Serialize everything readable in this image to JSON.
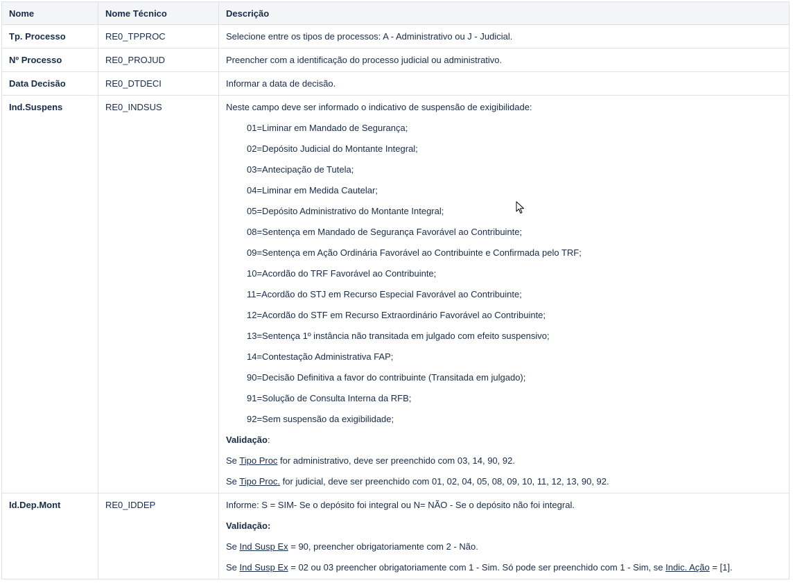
{
  "headers": [
    "Nome",
    "Nome Técnico",
    "Descrição"
  ],
  "rows": {
    "tp_processo": {
      "name": "Tp. Processo",
      "tech": "RE0_TPPROC",
      "desc": "Selecione entre os tipos de processos: A - Administrativo ou J - Judicial."
    },
    "n_processo": {
      "name": "Nº Processo",
      "tech": "RE0_PROJUD",
      "desc": "Preencher com a identificação do processo judicial ou administrativo."
    },
    "data_decisao": {
      "name": "Data Decisão",
      "tech": "RE0_DTDECI",
      "desc": "Informar a data de decisão."
    },
    "ind_suspens": {
      "name": "Ind.Suspens",
      "tech": "RE0_INDSUS",
      "intro": "Neste campo deve ser informado o indicativo de suspensão de exigibilidade:",
      "options": [
        "01=Liminar em Mandado de Segurança;",
        "02=Depósito Judicial do Montante Integral;",
        "03=Antecipação de Tutela;",
        "04=Liminar em Medida Cautelar;",
        "05=Depósito Administrativo do Montante Integral;",
        "08=Sentença em Mandado de Segurança Favorável ao Contribuinte;",
        "09=Sentença em Ação Ordinária Favorável ao Contribuinte e Confirmada pelo TRF;",
        "10=Acordão do TRF Favorável ao Contribuinte;",
        "11=Acordão do STJ em Recurso Especial Favorável ao Contribuinte;",
        "12=Acordão do STF em Recurso Extraordinário Favorável ao Contribuinte;",
        "13=Sentença 1º instância não transitada em julgado com efeito suspensivo;",
        "14=Contestação Administrativa FAP;",
        "90=Decisão Definitiva a favor do contribuinte (Transitada em julgado);",
        "91=Solução de Consulta Interna da RFB;",
        "92=Sem suspensão da exigibilidade;"
      ],
      "validation_label": "Validação",
      "validation_colon": ":",
      "v1_pre": "Se ",
      "v1_link": "Tipo Proc",
      "v1_post": " for administrativo, deve ser preenchido com 03, 14, 90, 92.",
      "v2_pre": "Se ",
      "v2_link": "Tipo Proc.",
      "v2_post": " for judicial, deve ser preenchido com 01, 02, 04, 05, 08, 09, 10, 11, 12, 13, 90, 92."
    },
    "id_dep_mont": {
      "name": "Id.Dep.Mont",
      "tech": "RE0_IDDEP",
      "intro": "Informe: S = SIM- Se o depósito foi integral ou N= NÃO - Se o depósito não foi integral.",
      "validation_label": "Validação:",
      "v1_pre": "Se ",
      "v1_link": "Ind Susp Ex",
      "v1_post": " = 90, preencher obrigatoriamente com 2 - Não.",
      "v2_pre": "Se ",
      "v2_link": "Ind Susp Ex",
      "v2_mid": " = 02 ou 03 preencher obrigatoriamente com 1 - Sim. Só pode ser preenchido com 1 - Sim, se ",
      "v2_link2": "Indic. Ação",
      "v2_post": " = [1]."
    }
  },
  "icons": {
    "cursor": "mouse-pointer-icon"
  },
  "colors": {
    "header_bg": "#f4f5f7",
    "border": "#dfe1e6",
    "text": "#172b4d"
  }
}
